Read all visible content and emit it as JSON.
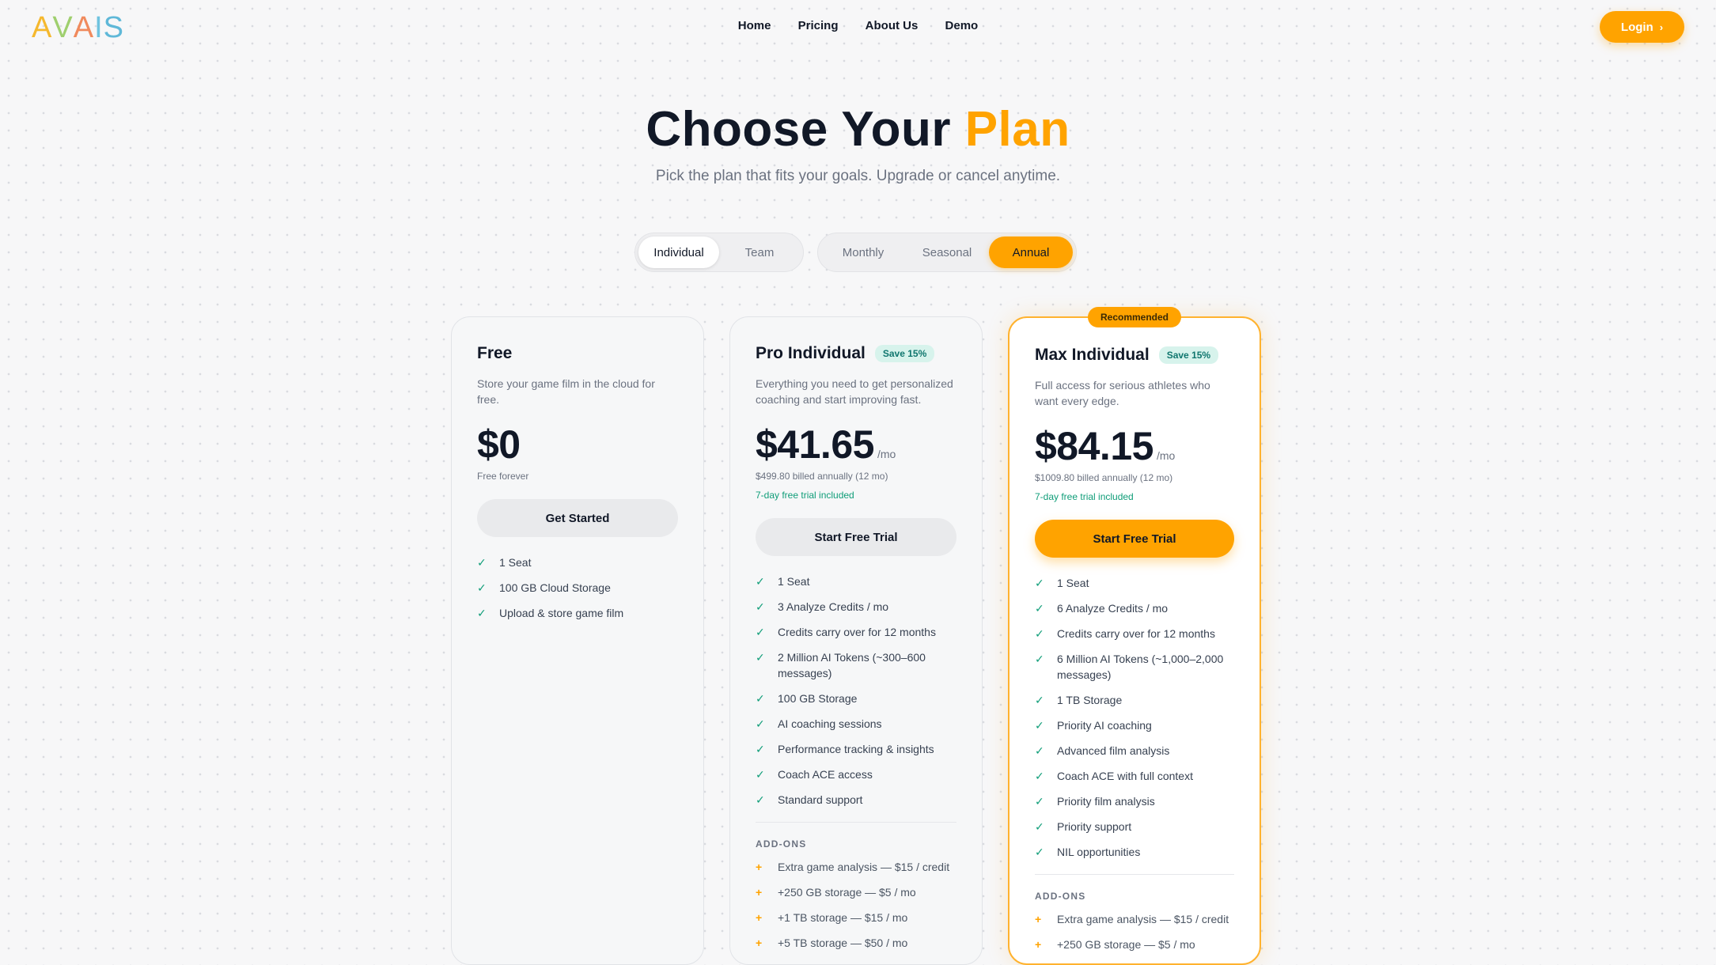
{
  "brand": {
    "logo_letters": [
      "A",
      "V",
      "A",
      "I",
      "S"
    ],
    "logo_colors": [
      "#f5b82e",
      "#9fcf6e",
      "#f08a5d",
      "#6fc3df",
      "#5fb8d8"
    ]
  },
  "nav": {
    "items": [
      "Home",
      "Pricing",
      "About Us",
      "Demo"
    ]
  },
  "header": {
    "login_label": "Login",
    "login_icon": "chevron-right-icon"
  },
  "hero": {
    "title_main": "Choose Your",
    "title_accent": "Plan",
    "subtitle": "Pick the plan that fits your goals. Upgrade or cancel anytime."
  },
  "toggles": {
    "audience": [
      "Individual",
      "Team"
    ],
    "audience_selected": "Individual",
    "billing": [
      "Monthly",
      "Seasonal",
      "Annual"
    ],
    "billing_selected": "Annual"
  },
  "colors": {
    "accent": "#ffa300",
    "success": "#0f9d78"
  },
  "plans": [
    {
      "name": "Free",
      "save_badge": "",
      "description": "Store your game film in the cloud for free.",
      "price": "$0",
      "per": "",
      "billed": "Free forever",
      "trial": "",
      "cta": "Get Started",
      "features": [
        "1 Seat",
        "100 GB Cloud Storage",
        "Upload & store game film"
      ],
      "addons_title": "",
      "addons": []
    },
    {
      "name": "Pro Individual",
      "save_badge": "Save 15%",
      "description": "Everything you need to get personalized coaching and start improving fast.",
      "price": "$41.65",
      "per": "/mo",
      "billed": "$499.80 billed annually (12 mo)",
      "trial": "7-day free trial included",
      "cta": "Start Free Trial",
      "features": [
        "1 Seat",
        "3 Analyze Credits / mo",
        "Credits carry over for 12 months",
        "2 Million AI Tokens (~300–600 messages)",
        "100 GB Storage",
        "AI coaching sessions",
        "Performance tracking & insights",
        "Coach ACE access",
        "Standard support"
      ],
      "addons_title": "ADD-ONS",
      "addons": [
        "Extra game analysis — $15 / credit",
        "+250 GB storage — $5 / mo",
        "+1 TB storage — $15 / mo",
        "+5 TB storage — $50 / mo"
      ]
    },
    {
      "name": "Max Individual",
      "save_badge": "Save 15%",
      "recommended": "Recommended",
      "description": "Full access for serious athletes who want every edge.",
      "price": "$84.15",
      "per": "/mo",
      "billed": "$1009.80 billed annually (12 mo)",
      "trial": "7-day free trial included",
      "cta": "Start Free Trial",
      "features": [
        "1 Seat",
        "6 Analyze Credits / mo",
        "Credits carry over for 12 months",
        "6 Million AI Tokens (~1,000–2,000 messages)",
        "1 TB Storage",
        "Priority AI coaching",
        "Advanced film analysis",
        "Coach ACE with full context",
        "Priority film analysis",
        "Priority support",
        "NIL opportunities"
      ],
      "addons_title": "ADD-ONS",
      "addons": [
        "Extra game analysis — $15 / credit",
        "+250 GB storage — $5 / mo"
      ]
    }
  ]
}
